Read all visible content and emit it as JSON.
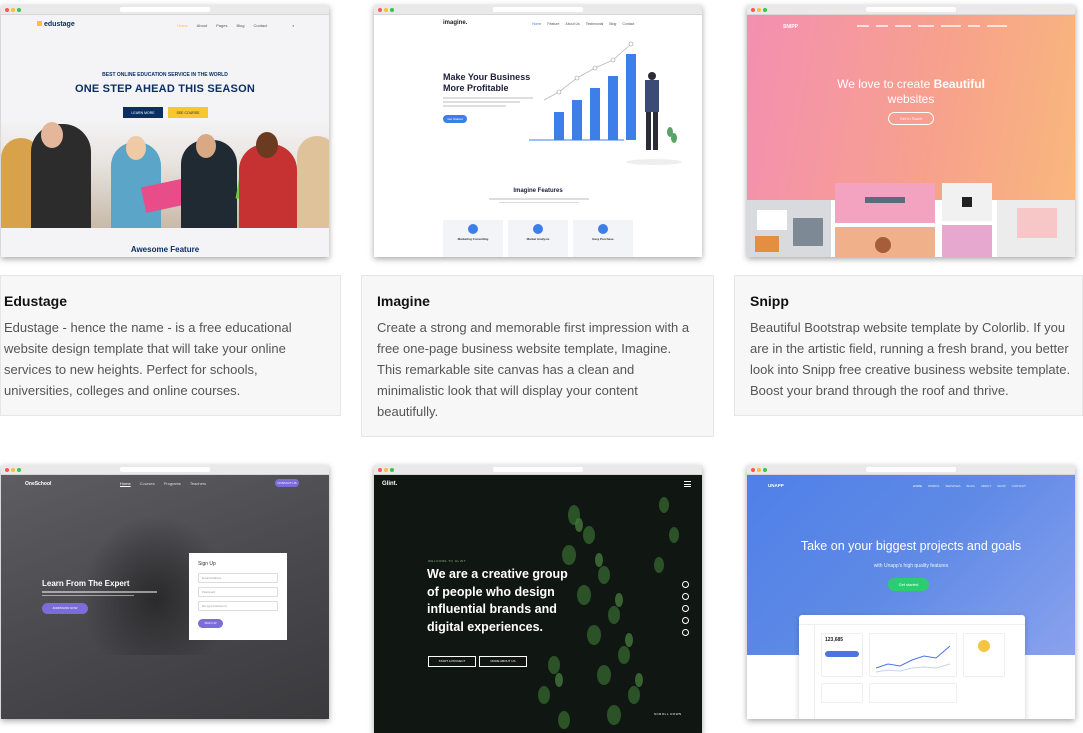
{
  "cards": [
    {
      "title": "Edustage",
      "description": "Edustage - hence the name - is a free educational website design template that will take your online services to new heights. Perfect for schools, universities, colleges and online courses.",
      "preview": {
        "logo": "edustage",
        "nav": [
          "Home",
          "About",
          "Pages",
          "Blog",
          "Contact"
        ],
        "kicker": "BEST ONLINE EDUCATION SERVICE IN THE WORLD",
        "headline": "ONE STEP AHEAD THIS SEASON",
        "btn1": "LEARN MORE",
        "btn2": "SEE COURSE",
        "footer_heading": "Awesome Feature"
      }
    },
    {
      "title": "Imagine",
      "description": "Create a strong and memorable first impression with a free one-page business website template, Imagine. This remarkable site canvas has a clean and minimalistic look that will display your content beautifully.",
      "preview": {
        "logo": "imagine.",
        "nav": [
          "Home",
          "Feature",
          "About Us",
          "Testimonial",
          "Blog",
          "Contact"
        ],
        "headline_line1": "Make Your Business",
        "headline_line2": "More Profitable",
        "cta": "Get Started",
        "section_title": "Imagine Features",
        "features": [
          "Marketing Consulting",
          "Market Analysis",
          "Easy Purchase"
        ]
      }
    },
    {
      "title": "Snipp",
      "description": "Beautiful Bootstrap website template by Colorlib. If you are in the artistic field, running a fresh brand, you better look into Snipp free creative business website template. Boost your brand through the roof and thrive.",
      "preview": {
        "logo": "SNIPP",
        "headline_plain": "We love to create ",
        "headline_bold": "Beautiful",
        "headline_line2": "websites",
        "cta": "Get In Touch"
      }
    },
    {
      "preview": {
        "logo": "OneSchool",
        "nav": [
          "Home",
          "Courses",
          "Programs",
          "Teachers"
        ],
        "nav_cta": "CONTACT US",
        "headline": "Learn From The Expert",
        "cta": "ADMISSION NOW",
        "form_title": "Sign Up",
        "fields": [
          "Email Address",
          "Password",
          "Re-type Password"
        ],
        "form_btn": "SIGN UP"
      }
    },
    {
      "preview": {
        "logo": "Glint.",
        "kicker": "WELCOME TO GLINT",
        "headline": [
          "We are a creative group",
          "of people who design",
          "influential brands and",
          "digital experiences."
        ],
        "btn1": "START A PROJECT",
        "btn2": "MORE ABOUT US",
        "scroll": "SCROLL DOWN"
      }
    },
    {
      "preview": {
        "logo": "UNAPP",
        "nav": [
          "HOME",
          "WORKS",
          "SERVICES",
          "BLOG",
          "ABOUT",
          "SHOP",
          "CONTACT"
        ],
        "headline": "Take on your biggest projects and goals",
        "subtitle": "with Unapp's high quality features",
        "cta": "Get started",
        "stat": "123,685"
      }
    }
  ],
  "colors": {
    "edustage_navy": "#0c2e60",
    "edustage_yellow": "#f9c530",
    "imagine_blue": "#3e7ee8",
    "snipp_gradient_start": "#f78ca0",
    "snipp_gradient_end": "#f9b16e",
    "oneschool_purple": "#7b6cd9",
    "unapp_blue": "#4a74e0",
    "unapp_green": "#2ecc71"
  }
}
